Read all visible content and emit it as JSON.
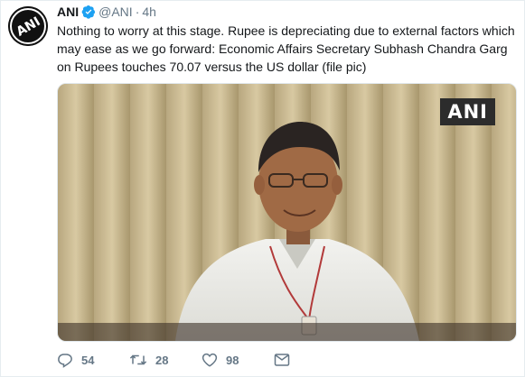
{
  "author": {
    "name": "ANI",
    "handle": "@ANI",
    "separator": "·",
    "time": "4h",
    "avatar_text": "ANI"
  },
  "tweet": {
    "text": "Nothing to worry at this stage. Rupee is depreciating due to external factors which may ease as we go forward: Economic Affairs Secretary Subhash Chandra Garg on Rupees touches 70.07 versus the US dollar (file pic)"
  },
  "media": {
    "watermark": "ANI"
  },
  "actions": {
    "reply_count": "54",
    "retweet_count": "28",
    "like_count": "98"
  },
  "colors": {
    "verified": "#1da1f2",
    "text": "#14171a",
    "muted": "#657786"
  },
  "icons": [
    "verified-badge-icon",
    "reply-icon",
    "retweet-icon",
    "like-icon",
    "direct-message-icon"
  ]
}
